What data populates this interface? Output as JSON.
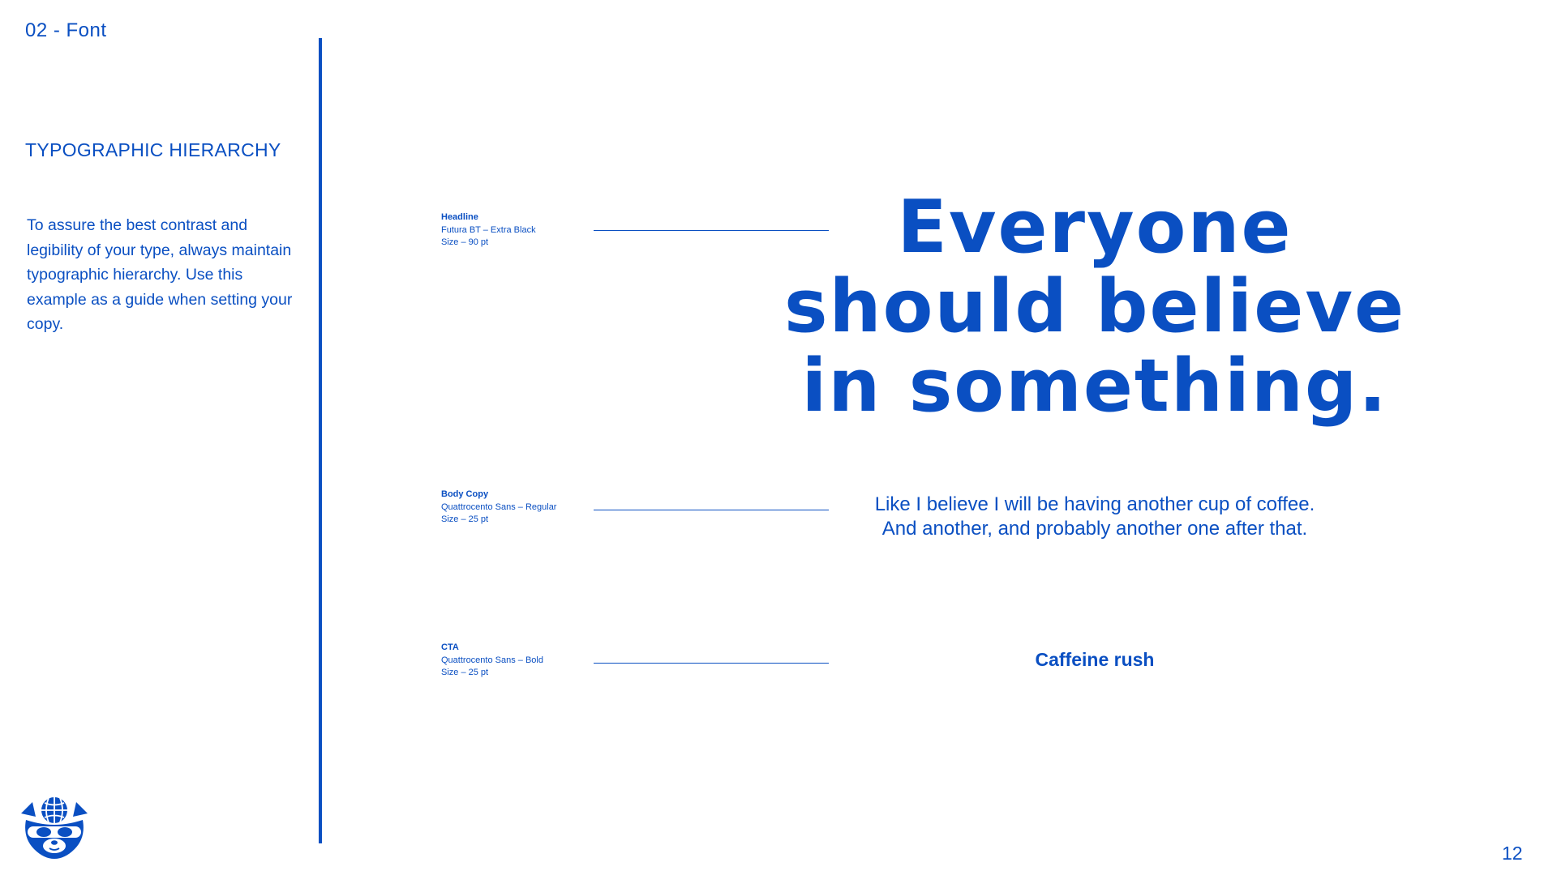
{
  "header": {
    "section_label": "02 - Font"
  },
  "sidebar": {
    "heading": "TYPOGRAPHIC HIERARCHY",
    "body": "To assure the best contrast and legibility of your type, always maintain typographic hierarchy. Use this example as a guide when setting your copy."
  },
  "specs": [
    {
      "title": "Headline",
      "font": "Futura BT – Extra Black",
      "size": "Size – 90 pt"
    },
    {
      "title": "Body Copy",
      "font": "Quattrocento Sans – Regular",
      "size": "Size – 25 pt"
    },
    {
      "title": "CTA",
      "font": "Quattrocento Sans – Bold",
      "size": "Size – 25 pt"
    }
  ],
  "examples": {
    "headline_lines": [
      "Everyone",
      "should believe",
      "in something."
    ],
    "body_lines": [
      "Like I believe I will be having another cup of coffee.",
      "And another, and probably another one after that."
    ],
    "cta": "Caffeine rush"
  },
  "footer": {
    "page_number": "12",
    "logo_icon": "cat-mascot-icon"
  },
  "colors": {
    "brand_blue": "#0a4fc2",
    "background": "#ffffff"
  }
}
